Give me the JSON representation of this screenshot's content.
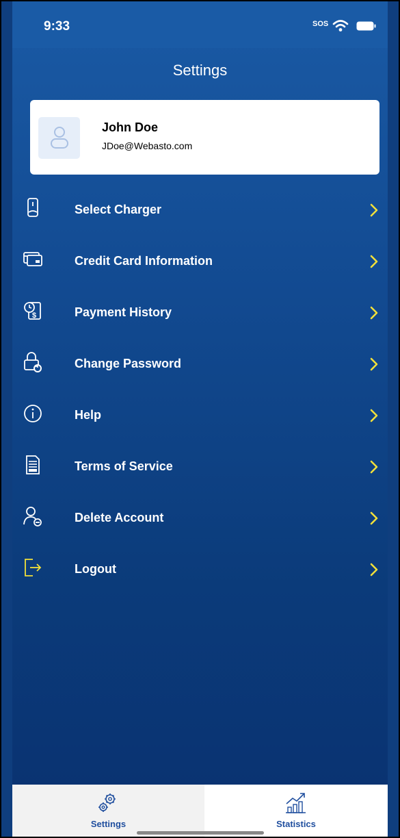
{
  "status_bar": {
    "time": "9:33",
    "sos": "SOS"
  },
  "header": {
    "title": "Settings"
  },
  "profile": {
    "name": "John Doe",
    "email": "JDoe@Webasto.com"
  },
  "menu": [
    {
      "label": "Select Charger",
      "icon": "charger-icon"
    },
    {
      "label": "Credit Card Information",
      "icon": "credit-card-icon"
    },
    {
      "label": "Payment History",
      "icon": "payment-history-icon"
    },
    {
      "label": "Change Password",
      "icon": "lock-refresh-icon"
    },
    {
      "label": "Help",
      "icon": "info-icon"
    },
    {
      "label": "Terms of Service",
      "icon": "document-icon"
    },
    {
      "label": "Delete Account",
      "icon": "user-remove-icon"
    },
    {
      "label": "Logout",
      "icon": "logout-icon"
    }
  ],
  "tabbar": {
    "settings_label": "Settings",
    "statistics_label": "Statistics"
  },
  "colors": {
    "accent_yellow": "#f2e03a",
    "tab_blue": "#1f4e9e"
  }
}
